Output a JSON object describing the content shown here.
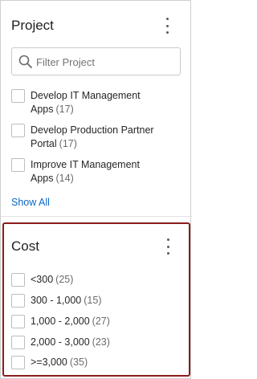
{
  "project": {
    "title": "Project",
    "search_placeholder": "Filter Project",
    "options": [
      {
        "line1": "Develop IT Management",
        "line2": "Apps",
        "count": "(17)"
      },
      {
        "line1": "Develop Production Partner",
        "line2": "Portal",
        "count": "(17)"
      },
      {
        "line1": "Improve IT Management",
        "line2": "Apps",
        "count": "(14)"
      }
    ],
    "show_all": "Show All"
  },
  "cost": {
    "title": "Cost",
    "options": [
      {
        "label": "<300",
        "count": "(25)"
      },
      {
        "label": "300 - 1,000",
        "count": "(15)"
      },
      {
        "label": "1,000 - 2,000",
        "count": "(27)"
      },
      {
        "label": "2,000 - 3,000",
        "count": "(23)"
      },
      {
        "label": ">=3,000",
        "count": "(35)"
      }
    ]
  },
  "icons": {
    "kebab": "more-vertical-icon",
    "search": "search-icon"
  },
  "colors": {
    "link": "#0b66c2",
    "highlight_border": "#8a1c1c"
  }
}
